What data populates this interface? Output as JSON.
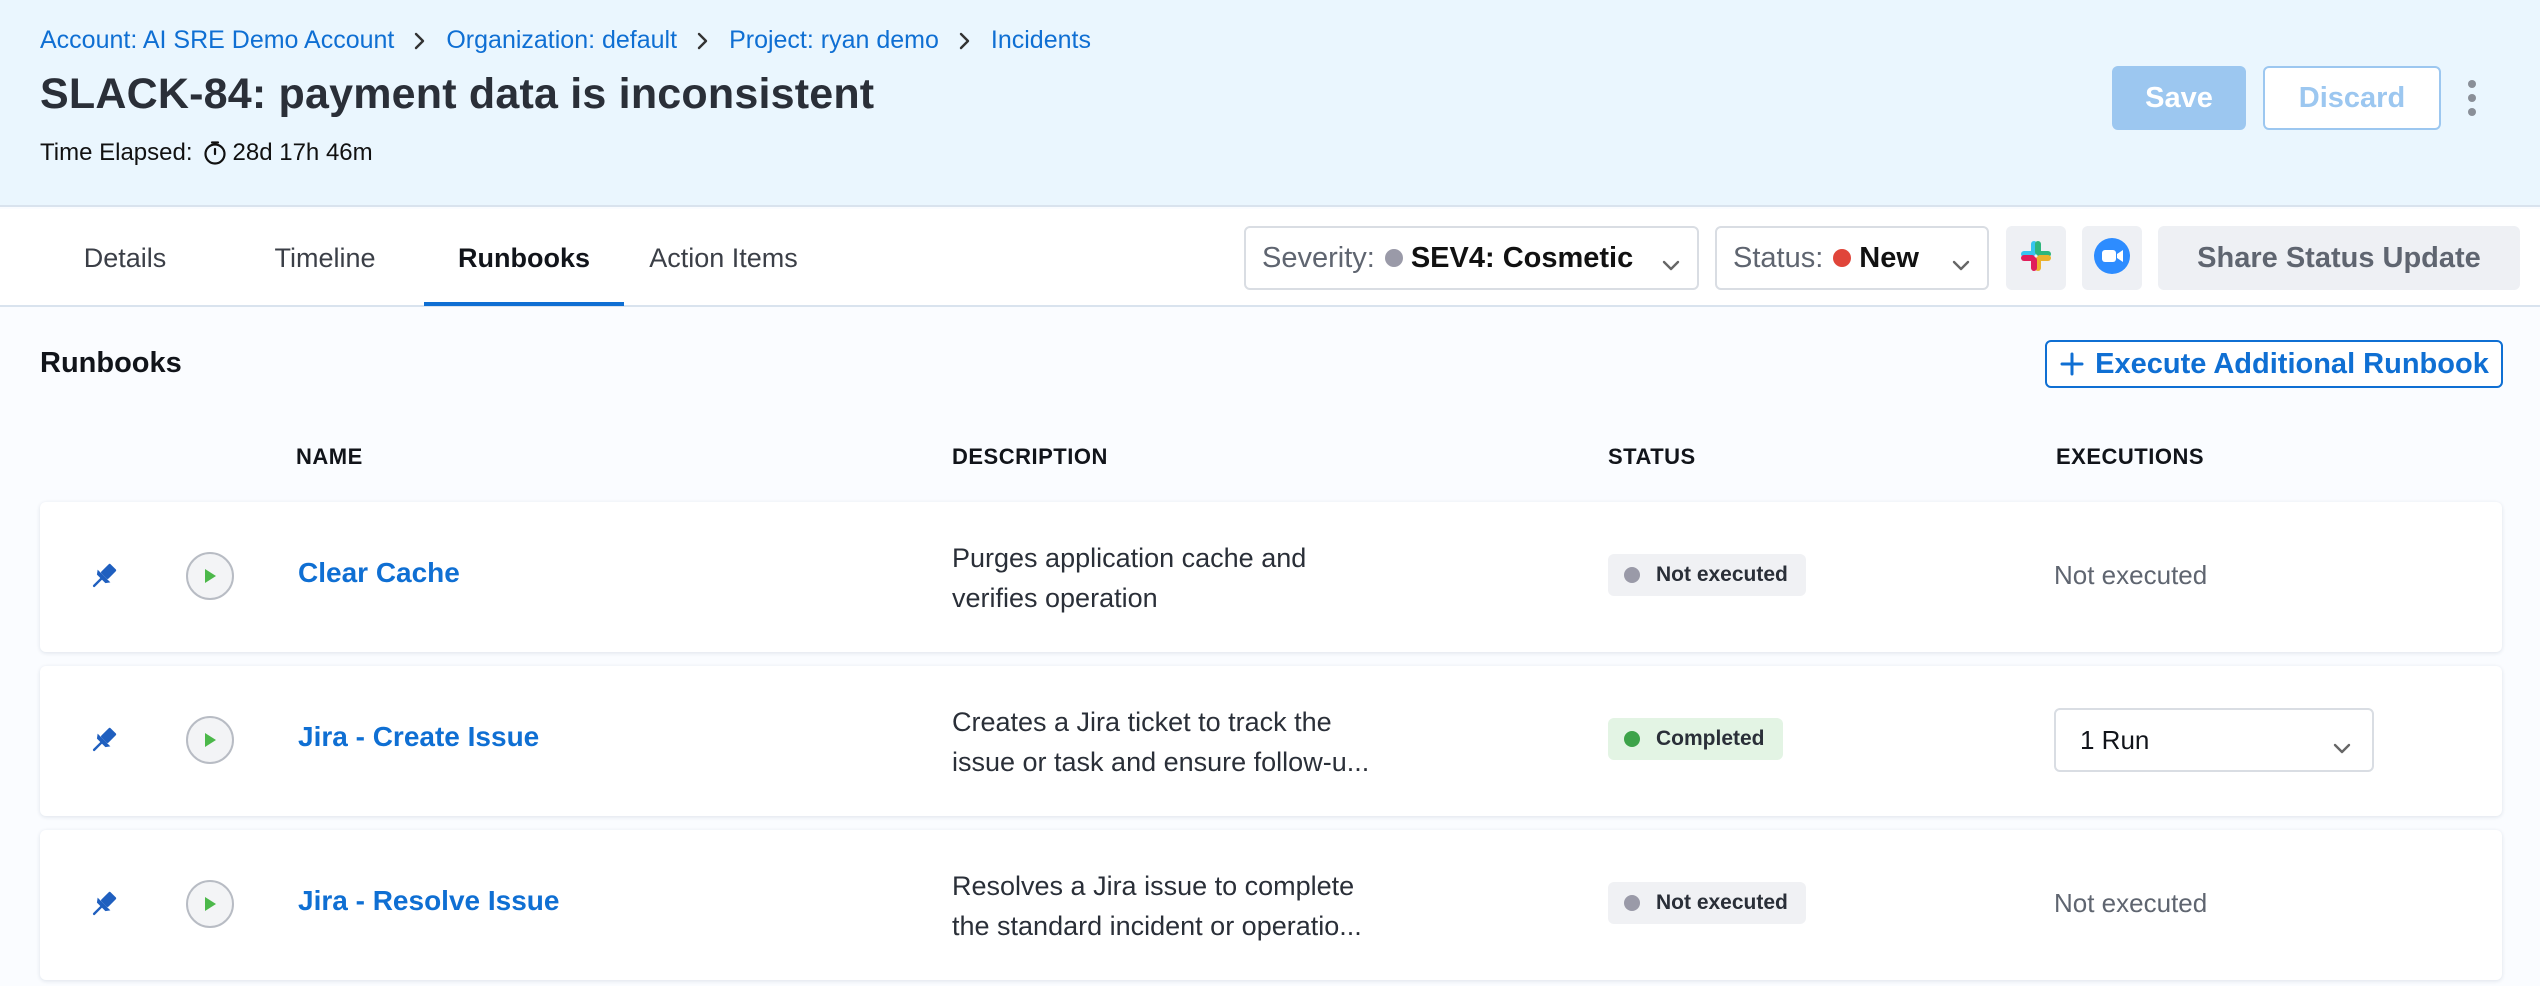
{
  "breadcrumb": [
    {
      "label": "Account: AI SRE Demo Account"
    },
    {
      "label": "Organization: default"
    },
    {
      "label": "Project: ryan demo"
    },
    {
      "label": "Incidents"
    }
  ],
  "incident": {
    "title": "SLACK-84: payment data is inconsistent",
    "elapsed_label": "Time Elapsed:",
    "elapsed_value": "28d 17h 46m"
  },
  "actions": {
    "save_label": "Save",
    "discard_label": "Discard"
  },
  "tabs": [
    {
      "label": "Details"
    },
    {
      "label": "Timeline"
    },
    {
      "label": "Runbooks",
      "active": true
    },
    {
      "label": "Action Items"
    }
  ],
  "severity": {
    "label": "Severity:",
    "value": "SEV4: Cosmetic",
    "dot_color": "#9a9aa8"
  },
  "status": {
    "label": "Status:",
    "value": "New",
    "dot_color": "#e0453a"
  },
  "integrations": [
    "slack-icon",
    "zoom-icon"
  ],
  "share_label": "Share Status Update",
  "runbooks": {
    "title": "Runbooks",
    "execute_label": "Execute Additional Runbook",
    "columns": {
      "name": "NAME",
      "description": "DESCRIPTION",
      "status": "STATUS",
      "executions": "EXECUTIONS"
    },
    "rows": [
      {
        "name": "Clear Cache",
        "description": "Purges application cache and verifies operation",
        "status": "Not executed",
        "status_color": "#9a9aa8",
        "status_bg": "#f0f1f4",
        "executions": "Not executed"
      },
      {
        "name": "Jira - Create Issue",
        "description": "Creates a Jira ticket to track the issue or task and ensure follow-u...",
        "status": "Completed",
        "status_color": "#3da34a",
        "status_bg": "#e3f4e4",
        "executions": "1 Run"
      },
      {
        "name": "Jira - Resolve Issue",
        "description": "Resolves a Jira issue to complete the standard incident or operatio...",
        "status": "Not executed",
        "status_color": "#9a9aa8",
        "status_bg": "#f0f1f4",
        "executions": "Not executed"
      }
    ]
  },
  "colors": {
    "brand_blue": "#0f6fd3",
    "header_bg": "#eaf6fe",
    "save_disabled": "#9cc7f0"
  }
}
